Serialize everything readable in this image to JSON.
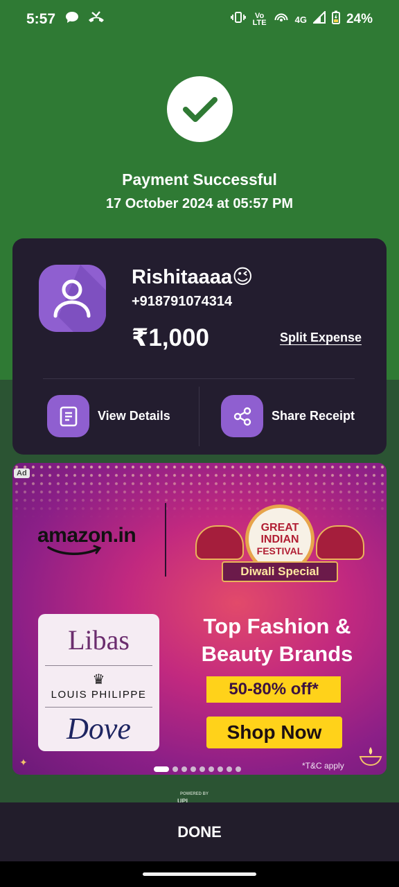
{
  "status_bar": {
    "time": "5:57",
    "network_label": "4G",
    "volte_label": "Vo LTE",
    "battery": "24%"
  },
  "success": {
    "title": "Payment Successful",
    "datetime": "17 October 2024 at 05:57 PM"
  },
  "payee": {
    "name": "Rishitaaaa😉",
    "phone": "+918791074314",
    "amount": "₹1,000",
    "split_label": "Split Expense"
  },
  "actions": {
    "view_details": "View Details",
    "share_receipt": "Share Receipt"
  },
  "ad": {
    "badge": "Ad",
    "brand": "amazon.in",
    "festival_line1": "GREAT",
    "festival_line2": "INDIAN",
    "festival_line3": "FESTIVAL",
    "festival_banner": "Diwali Special",
    "brand_libas": "Libas",
    "brand_lp": "LOUIS PHILIPPE",
    "brand_dove": "Dove",
    "tagline": "Top Fashion & Beauty Brands",
    "offer": "50-80% off*",
    "cta": "Shop Now",
    "tnc": "*T&C apply",
    "carousel_count": 9,
    "carousel_active": 1
  },
  "footer": {
    "powered_by": "POWERED BY",
    "done_label": "DONE"
  },
  "colors": {
    "header_green": "#2f7a34",
    "dark_green": "#2b5433",
    "card_bg": "#231d2f",
    "accent_purple": "#8f5fd0",
    "ad_yellow": "#ffd21a"
  }
}
